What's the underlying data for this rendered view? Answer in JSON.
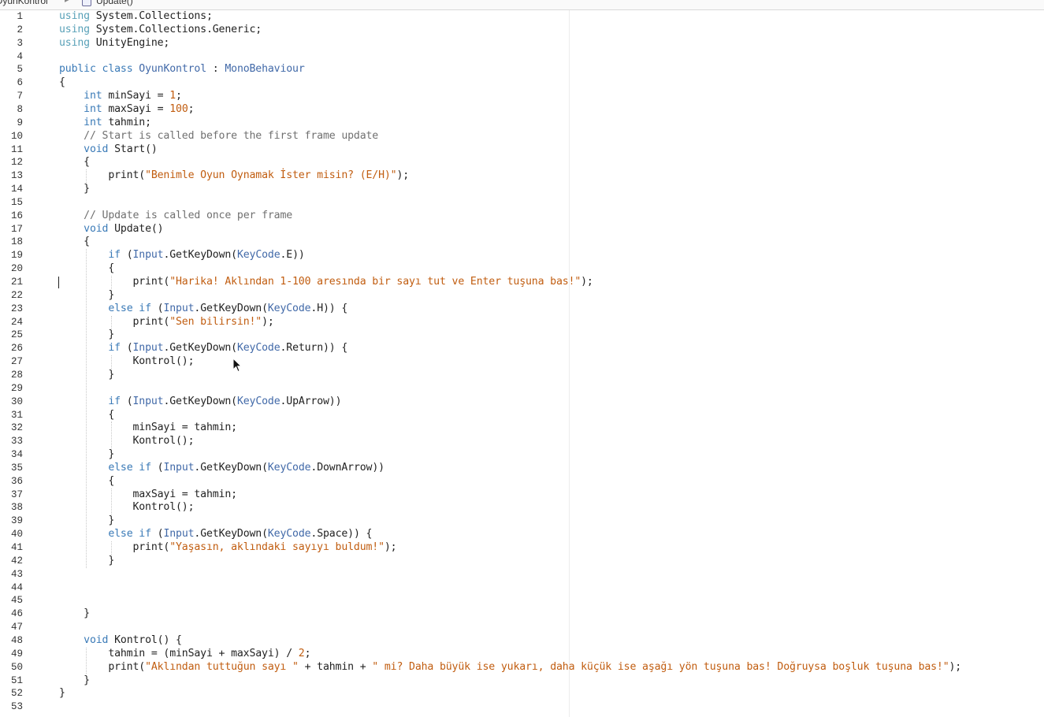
{
  "breadcrumb": {
    "class_name": "OyunKontrol",
    "separator": "▸",
    "method_name": "Update()"
  },
  "editor": {
    "language": "C#",
    "caret_line": 21,
    "colors": {
      "keyword": "#3a7ab7",
      "using_keyword": "#59a1b8",
      "type": "#4169a8",
      "string": "#c15d10",
      "number": "#c15d10",
      "comment": "#707070",
      "text": "#222222"
    },
    "lines": [
      {
        "n": "1",
        "tokens": [
          [
            "using",
            "using"
          ],
          [
            "plain",
            " System.Collections;"
          ]
        ]
      },
      {
        "n": "2",
        "tokens": [
          [
            "using",
            "using"
          ],
          [
            "plain",
            " System.Collections.Generic;"
          ]
        ]
      },
      {
        "n": "3",
        "tokens": [
          [
            "using",
            "using"
          ],
          [
            "plain",
            " UnityEngine;"
          ]
        ]
      },
      {
        "n": "4",
        "tokens": []
      },
      {
        "n": "5",
        "tokens": [
          [
            "kw",
            "public"
          ],
          [
            "plain",
            " "
          ],
          [
            "kw",
            "class"
          ],
          [
            "plain",
            " "
          ],
          [
            "type",
            "OyunKontrol"
          ],
          [
            "plain",
            " : "
          ],
          [
            "type",
            "MonoBehaviour"
          ]
        ]
      },
      {
        "n": "6",
        "tokens": [
          [
            "plain",
            "{"
          ]
        ]
      },
      {
        "n": "7",
        "tokens": [
          [
            "plain",
            "    "
          ],
          [
            "kw",
            "int"
          ],
          [
            "plain",
            " minSayi = "
          ],
          [
            "num",
            "1"
          ],
          [
            "plain",
            ";"
          ]
        ]
      },
      {
        "n": "8",
        "tokens": [
          [
            "plain",
            "    "
          ],
          [
            "kw",
            "int"
          ],
          [
            "plain",
            " maxSayi = "
          ],
          [
            "num",
            "100"
          ],
          [
            "plain",
            ";"
          ]
        ]
      },
      {
        "n": "9",
        "tokens": [
          [
            "plain",
            "    "
          ],
          [
            "kw",
            "int"
          ],
          [
            "plain",
            " tahmin;"
          ]
        ]
      },
      {
        "n": "10",
        "tokens": [
          [
            "plain",
            "    "
          ],
          [
            "com",
            "// Start is called before the first frame update"
          ]
        ]
      },
      {
        "n": "11",
        "tokens": [
          [
            "plain",
            "    "
          ],
          [
            "kw",
            "void"
          ],
          [
            "plain",
            " Start()"
          ]
        ]
      },
      {
        "n": "12",
        "tokens": [
          [
            "plain",
            "    {"
          ]
        ]
      },
      {
        "n": "13",
        "tokens": [
          [
            "plain",
            "        print("
          ],
          [
            "str",
            "\"Benimle Oyun Oynamak İster misin? (E/H)\""
          ],
          [
            "plain",
            ");"
          ]
        ]
      },
      {
        "n": "14",
        "tokens": [
          [
            "plain",
            "    }"
          ]
        ]
      },
      {
        "n": "15",
        "tokens": []
      },
      {
        "n": "16",
        "tokens": [
          [
            "plain",
            "    "
          ],
          [
            "com",
            "// Update is called once per frame"
          ]
        ]
      },
      {
        "n": "17",
        "tokens": [
          [
            "plain",
            "    "
          ],
          [
            "kw",
            "void"
          ],
          [
            "plain",
            " Update()"
          ]
        ]
      },
      {
        "n": "18",
        "tokens": [
          [
            "plain",
            "    {"
          ]
        ]
      },
      {
        "n": "19",
        "tokens": [
          [
            "plain",
            "        "
          ],
          [
            "kw",
            "if"
          ],
          [
            "plain",
            " ("
          ],
          [
            "type",
            "Input"
          ],
          [
            "plain",
            ".GetKeyDown("
          ],
          [
            "type",
            "KeyCode"
          ],
          [
            "plain",
            ".E))"
          ]
        ]
      },
      {
        "n": "20",
        "tokens": [
          [
            "plain",
            "        {"
          ]
        ]
      },
      {
        "n": "21",
        "tokens": [
          [
            "plain",
            "            print("
          ],
          [
            "str",
            "\"Harika! Aklından 1-100 aresında bir sayı tut ve Enter tuşuna bas!\""
          ],
          [
            "plain",
            ");"
          ]
        ]
      },
      {
        "n": "22",
        "tokens": [
          [
            "plain",
            "        }"
          ]
        ]
      },
      {
        "n": "23",
        "tokens": [
          [
            "plain",
            "        "
          ],
          [
            "kw",
            "else if"
          ],
          [
            "plain",
            " ("
          ],
          [
            "type",
            "Input"
          ],
          [
            "plain",
            ".GetKeyDown("
          ],
          [
            "type",
            "KeyCode"
          ],
          [
            "plain",
            ".H)) {"
          ]
        ]
      },
      {
        "n": "24",
        "tokens": [
          [
            "plain",
            "            print("
          ],
          [
            "str",
            "\"Sen bilirsin!\""
          ],
          [
            "plain",
            ");"
          ]
        ]
      },
      {
        "n": "25",
        "tokens": [
          [
            "plain",
            "        }"
          ]
        ]
      },
      {
        "n": "26",
        "tokens": [
          [
            "plain",
            "        "
          ],
          [
            "kw",
            "if"
          ],
          [
            "plain",
            " ("
          ],
          [
            "type",
            "Input"
          ],
          [
            "plain",
            ".GetKeyDown("
          ],
          [
            "type",
            "KeyCode"
          ],
          [
            "plain",
            ".Return)) {"
          ]
        ]
      },
      {
        "n": "27",
        "tokens": [
          [
            "plain",
            "            Kontrol();"
          ]
        ]
      },
      {
        "n": "28",
        "tokens": [
          [
            "plain",
            "        }"
          ]
        ]
      },
      {
        "n": "29",
        "tokens": []
      },
      {
        "n": "30",
        "tokens": [
          [
            "plain",
            "        "
          ],
          [
            "kw",
            "if"
          ],
          [
            "plain",
            " ("
          ],
          [
            "type",
            "Input"
          ],
          [
            "plain",
            ".GetKeyDown("
          ],
          [
            "type",
            "KeyCode"
          ],
          [
            "plain",
            ".UpArrow))"
          ]
        ]
      },
      {
        "n": "31",
        "tokens": [
          [
            "plain",
            "        {"
          ]
        ]
      },
      {
        "n": "32",
        "tokens": [
          [
            "plain",
            "            minSayi = tahmin;"
          ]
        ]
      },
      {
        "n": "33",
        "tokens": [
          [
            "plain",
            "            Kontrol();"
          ]
        ]
      },
      {
        "n": "34",
        "tokens": [
          [
            "plain",
            "        }"
          ]
        ]
      },
      {
        "n": "35",
        "tokens": [
          [
            "plain",
            "        "
          ],
          [
            "kw",
            "else if"
          ],
          [
            "plain",
            " ("
          ],
          [
            "type",
            "Input"
          ],
          [
            "plain",
            ".GetKeyDown("
          ],
          [
            "type",
            "KeyCode"
          ],
          [
            "plain",
            ".DownArrow))"
          ]
        ]
      },
      {
        "n": "36",
        "tokens": [
          [
            "plain",
            "        {"
          ]
        ]
      },
      {
        "n": "37",
        "tokens": [
          [
            "plain",
            "            maxSayi = tahmin;"
          ]
        ]
      },
      {
        "n": "38",
        "tokens": [
          [
            "plain",
            "            Kontrol();"
          ]
        ]
      },
      {
        "n": "39",
        "tokens": [
          [
            "plain",
            "        }"
          ]
        ]
      },
      {
        "n": "40",
        "tokens": [
          [
            "plain",
            "        "
          ],
          [
            "kw",
            "else if"
          ],
          [
            "plain",
            " ("
          ],
          [
            "type",
            "Input"
          ],
          [
            "plain",
            ".GetKeyDown("
          ],
          [
            "type",
            "KeyCode"
          ],
          [
            "plain",
            ".Space)) {"
          ]
        ]
      },
      {
        "n": "41",
        "tokens": [
          [
            "plain",
            "            print("
          ],
          [
            "str",
            "\"Yaşasın, aklındaki sayıyı buldum!\""
          ],
          [
            "plain",
            ");"
          ]
        ]
      },
      {
        "n": "42",
        "tokens": [
          [
            "plain",
            "        }"
          ]
        ]
      },
      {
        "n": "43",
        "tokens": []
      },
      {
        "n": "44",
        "tokens": []
      },
      {
        "n": "45",
        "tokens": []
      },
      {
        "n": "46",
        "tokens": [
          [
            "plain",
            "    }"
          ]
        ]
      },
      {
        "n": "47",
        "tokens": []
      },
      {
        "n": "48",
        "tokens": [
          [
            "plain",
            "    "
          ],
          [
            "kw",
            "void"
          ],
          [
            "plain",
            " Kontrol() {"
          ]
        ]
      },
      {
        "n": "49",
        "tokens": [
          [
            "plain",
            "        tahmin = (minSayi + maxSayi) / "
          ],
          [
            "num",
            "2"
          ],
          [
            "plain",
            ";"
          ]
        ]
      },
      {
        "n": "50",
        "tokens": [
          [
            "plain",
            "        print("
          ],
          [
            "str",
            "\"Aklından tuttuğun sayı \""
          ],
          [
            "plain",
            " + tahmin + "
          ],
          [
            "str",
            "\" mi? Daha büyük ise yukarı, daha küçük ise aşağı yön tuşuna bas! Doğruysa boşluk tuşuna bas!\""
          ],
          [
            "plain",
            ");"
          ]
        ]
      },
      {
        "n": "51",
        "tokens": [
          [
            "plain",
            "    }"
          ]
        ]
      },
      {
        "n": "52",
        "tokens": [
          [
            "plain",
            "}"
          ]
        ]
      },
      {
        "n": "53",
        "tokens": []
      }
    ]
  }
}
